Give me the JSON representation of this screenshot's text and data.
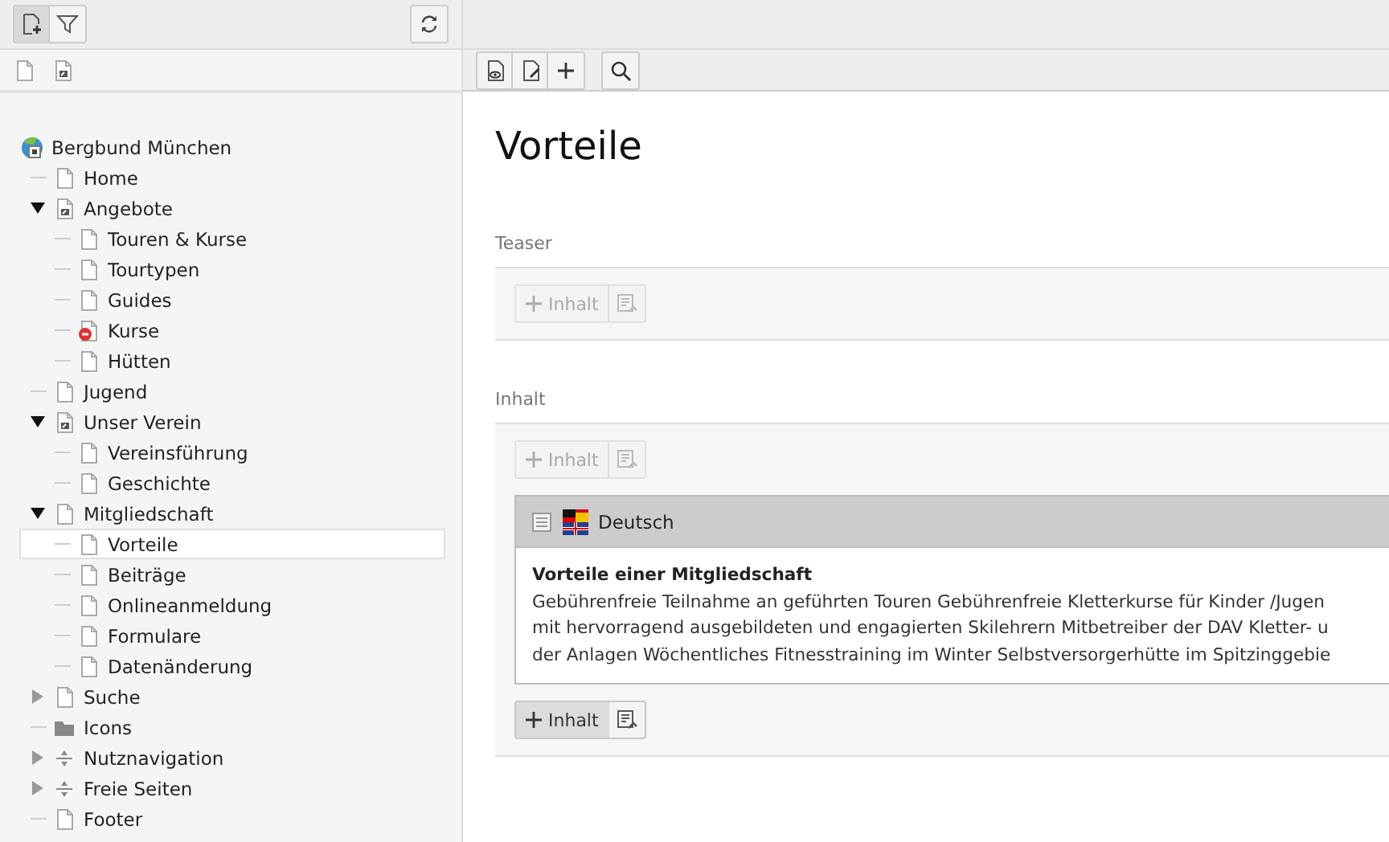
{
  "tree_toolbar": {
    "buttons": [
      {
        "kind": "new-page",
        "selected": true
      },
      {
        "kind": "filter",
        "selected": false
      }
    ]
  },
  "page_types": [
    {
      "kind": "page"
    },
    {
      "kind": "shortcut"
    }
  ],
  "tree": [
    {
      "label": "Bergbund München",
      "kind": "site",
      "selected": false,
      "children": [
        {
          "label": "Home",
          "kind": "page",
          "selected": false
        },
        {
          "label": "Angebote",
          "kind": "shortcut",
          "selected": false,
          "expanded": true,
          "children": [
            {
              "label": "Touren & Kurse",
              "kind": "page",
              "selected": false
            },
            {
              "label": "Tourtypen",
              "kind": "page",
              "selected": false
            },
            {
              "label": "Guides",
              "kind": "page",
              "selected": false
            },
            {
              "label": "Kurse",
              "kind": "hidden",
              "selected": false
            },
            {
              "label": "Hütten",
              "kind": "page",
              "selected": false
            }
          ]
        },
        {
          "label": "Jugend",
          "kind": "page",
          "selected": false
        },
        {
          "label": "Unser Verein",
          "kind": "shortcut",
          "selected": false,
          "expanded": true,
          "children": [
            {
              "label": "Vereinsführung",
              "kind": "page",
              "selected": false
            },
            {
              "label": "Geschichte",
              "kind": "page",
              "selected": false
            }
          ]
        },
        {
          "label": "Mitgliedschaft",
          "kind": "page",
          "selected": false,
          "expanded": true,
          "children": [
            {
              "label": "Vorteile",
              "kind": "page",
              "selected": true
            },
            {
              "label": "Beiträge",
              "kind": "page",
              "selected": false
            },
            {
              "label": "Onlineanmeldung",
              "kind": "page",
              "selected": false
            },
            {
              "label": "Formulare",
              "kind": "page",
              "selected": false
            },
            {
              "label": "Datenänderung",
              "kind": "page",
              "selected": false
            }
          ]
        },
        {
          "label": "Suche",
          "kind": "page",
          "selected": false,
          "expanded": false
        },
        {
          "label": "Icons",
          "kind": "folder",
          "selected": false
        },
        {
          "label": "Nutznavigation",
          "kind": "separator",
          "selected": false,
          "expanded": false
        },
        {
          "label": "Freie Seiten",
          "kind": "separator",
          "selected": false,
          "expanded": false
        },
        {
          "label": "Footer",
          "kind": "page",
          "selected": false
        }
      ]
    }
  ],
  "page_toolbar": {
    "groups": [
      [
        {
          "kind": "view"
        },
        {
          "kind": "edit"
        },
        {
          "kind": "add"
        }
      ],
      [
        {
          "kind": "search"
        }
      ]
    ]
  },
  "page_title": "Vorteile",
  "columns": [
    {
      "name": "Teaser",
      "items": [
        {
          "kind": "add",
          "label": "Inhalt",
          "disabled": true
        }
      ]
    },
    {
      "name": "Inhalt",
      "items": [
        {
          "kind": "add",
          "label": "Inhalt",
          "disabled": true
        },
        {
          "kind": "element",
          "language": "Deutsch",
          "heading": "Vorteile einer Mitgliedschaft",
          "lines": [
            "Gebührenfreie Teilnahme an geführten Touren Gebührenfreie Kletterkurse für Kinder /Jugen",
            "mit hervorragend ausgebildeten und engagierten Skilehrern Mitbetreiber der DAV Kletter- u",
            "der Anlagen Wöchentliches Fitnesstraining im Winter Selbstversorgerhütte im Spitzinggebie"
          ]
        },
        {
          "kind": "add",
          "label": "Inhalt",
          "disabled": false
        }
      ]
    }
  ]
}
